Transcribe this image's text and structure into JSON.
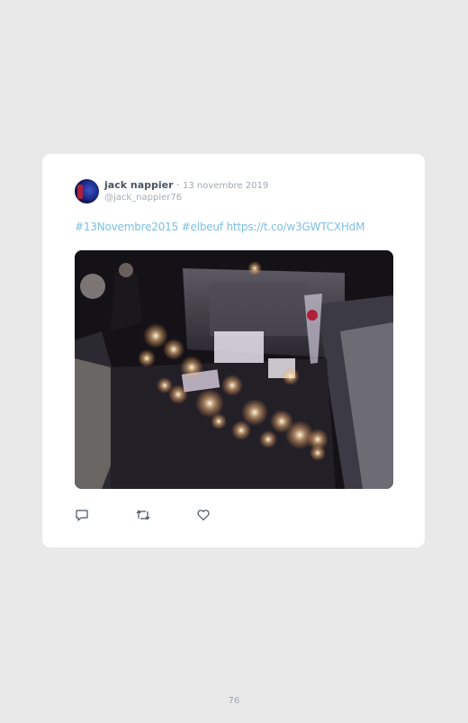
{
  "tweet": {
    "author_name": "jack nappier",
    "separator": "·",
    "date": "13 novembre 2019",
    "handle": "@jack_nappier76",
    "hashtag_1": "#13Novembre2015",
    "hashtag_2": "#elbeuf",
    "link": "https://t.co/w3GWTCXHdM",
    "media_icon": "candle-memorial-photo",
    "actions": [
      {
        "name": "reply",
        "icon": "reply-icon"
      },
      {
        "name": "retweet",
        "icon": "retweet-icon"
      },
      {
        "name": "like",
        "icon": "heart-icon"
      }
    ]
  },
  "colors": {
    "link": "#7cbfe3",
    "name": "#4a5560",
    "meta": "#a0a8b0",
    "background": "#e9e9e9",
    "card": "#ffffff"
  },
  "footer": {
    "page_number": "76"
  }
}
